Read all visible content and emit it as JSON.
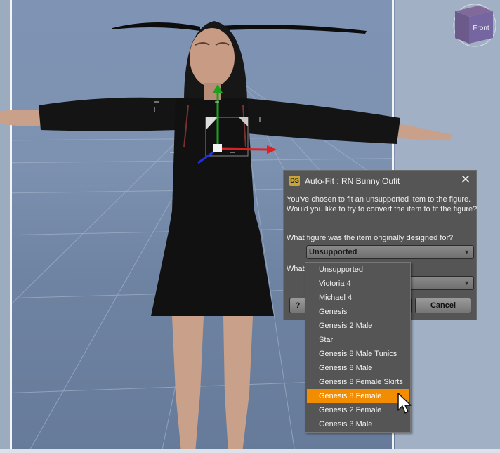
{
  "colors": {
    "highlight": "#f28c00",
    "dialog_bg": "#555555"
  },
  "viewport": {
    "view_cube_label": "Front"
  },
  "dialog": {
    "logo": "DS",
    "title": "Auto-Fit : RN Bunny Oufit",
    "message_line1": "You've chosen to fit an unsupported item to the figure.",
    "message_line2": "Would you like to try to convert the item to fit the figure?",
    "question1": "What figure was the item originally designed for?",
    "figure_select_value": "Unsupported",
    "question2_visible": "What",
    "ok_label": "",
    "cancel_label": "Cancel"
  },
  "dropdown": {
    "options": [
      "Unsupported",
      "Victoria 4",
      "Michael 4",
      "Genesis",
      "Genesis 2 Male",
      "Star",
      "Genesis 8 Male Tunics",
      "Genesis 8 Male",
      "Genesis 8 Female Skirts",
      "Genesis 8 Female",
      "Genesis 2 Female",
      "Genesis 3 Male"
    ],
    "highlighted": "Genesis 8 Female"
  }
}
